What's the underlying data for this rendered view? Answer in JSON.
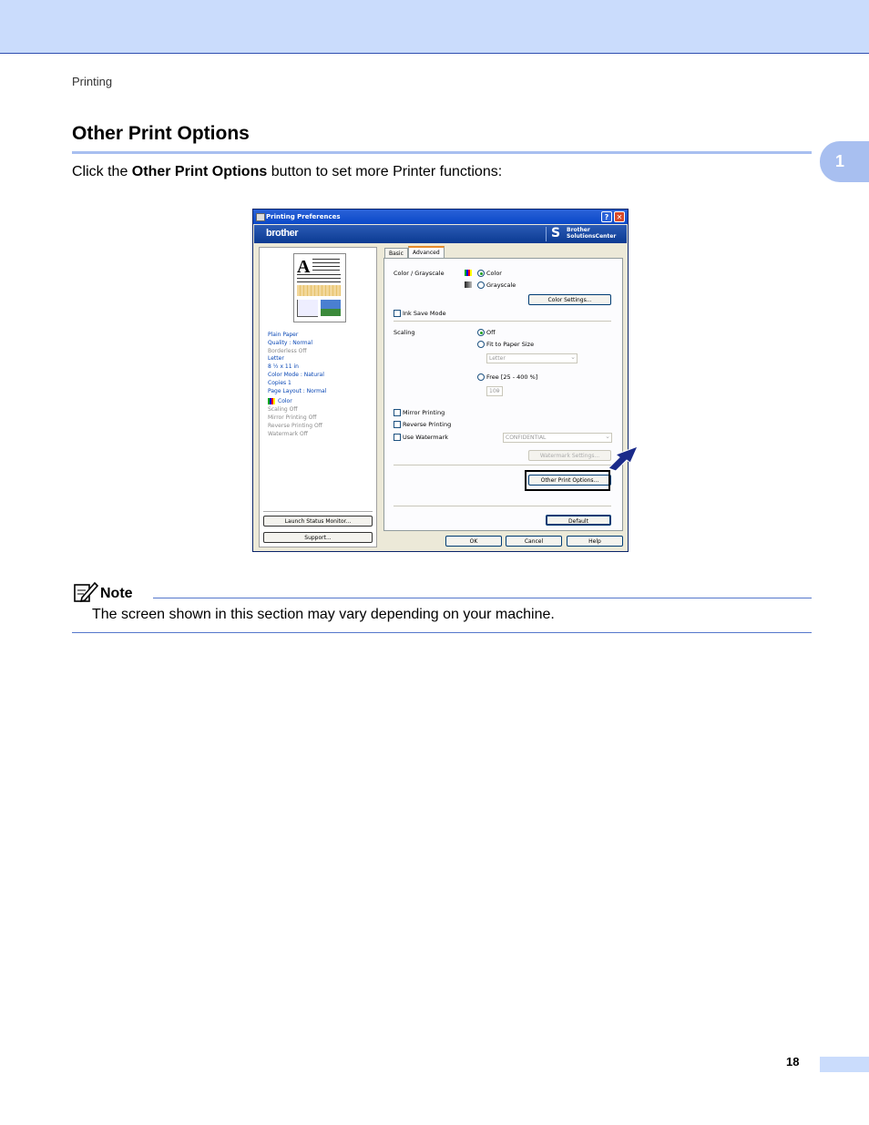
{
  "header": {
    "section": "Printing"
  },
  "chapter_tab": "1",
  "heading": "Other Print Options",
  "intro": {
    "before": "Click the ",
    "bold": "Other Print Options",
    "after": " button to set more Printer functions:"
  },
  "dialog": {
    "title": "Printing Preferences",
    "brand": "brother",
    "solutions": [
      "Brother",
      "SolutionsCenter"
    ],
    "tabs": [
      "Basic",
      "Advanced"
    ],
    "summary_blue": [
      "Plain Paper",
      "Quality : Normal"
    ],
    "summary_grey1": "Borderless Off",
    "summary_blue2": [
      "Letter",
      "8 ½ x 11 in",
      "Color Mode : Natural",
      "Copies 1",
      "Page Layout : Normal"
    ],
    "summary_color": "Color",
    "summary_grey2": [
      "Scaling Off",
      "Mirror Printing Off",
      "Reverse Printing Off",
      "Watermark Off"
    ],
    "launch_status": "Launch Status Monitor...",
    "support": "Support...",
    "color_grayscale_label": "Color / Grayscale",
    "color_option": "Color",
    "grayscale_option": "Grayscale",
    "color_settings": "Color Settings...",
    "ink_save": "Ink Save Mode",
    "scaling_label": "Scaling",
    "scaling_off": "Off",
    "fit_to_paper": "Fit to Paper Size",
    "paper_select": "Letter",
    "free": "Free [25 - 400 %]",
    "free_value": "100",
    "mirror": "Mirror Printing",
    "reverse": "Reverse Printing",
    "watermark": "Use Watermark",
    "watermark_select": "CONFIDENTIAL",
    "watermark_settings": "Watermark Settings...",
    "other_print_options": "Other Print Options...",
    "default": "Default",
    "ok": "OK",
    "cancel": "Cancel",
    "help": "Help"
  },
  "note": {
    "title": "Note",
    "text": "The screen shown in this section may vary depending on your machine."
  },
  "page_number": "18",
  "colors": {
    "band": "#cadcfc",
    "rule": "#a8bff0",
    "arrow": "#1a2a8a"
  }
}
